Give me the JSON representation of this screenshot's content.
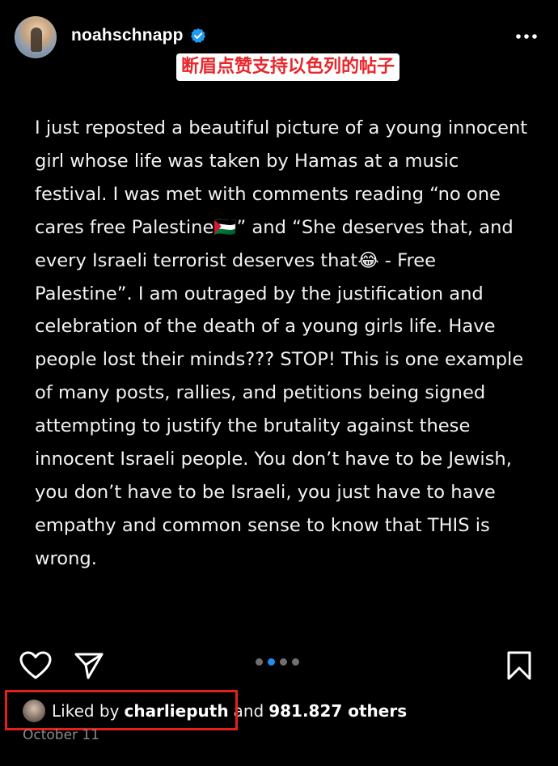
{
  "post": {
    "username": "noahschnapp",
    "verified_icon": "verified-badge-icon",
    "more_icon": "more-horizontal-icon",
    "overlay_label": "断眉点赞支持以色列的帖子",
    "caption": {
      "part1": "I just reposted a beautiful picture of a young innocent girl whose life was taken by Hamas at a music festival. I was met with comments reading “no one cares free Palestine",
      "flag_emoji": "🇵🇸",
      "part2": "” and “She deserves that, and every Israeli terrorist deserves that",
      "laugh_emoji": "😂",
      "part3": " - Free Palestine”. I am outraged by the justification and celebration of the death of a young girls life. Have people lost their minds??? STOP! This is one example of many posts, rallies, and petitions being signed attempting to justify the brutality against these innocent Israeli people. You don’t have to be Jewish, you don’t have to be Israeli, you just have to have empathy and common sense to know that THIS is wrong."
    },
    "carousel": {
      "total": 4,
      "active_index": 1
    },
    "likes": {
      "prefix": "Liked by",
      "liker": "charlieputh",
      "connector": "and",
      "count_text": "981.827 others"
    },
    "date": "October 11"
  },
  "colors": {
    "background": "#000000",
    "verified": "#1d9bf0",
    "highlight_box": "#e3201f",
    "overlay_text": "#e8262b",
    "carousel_active": "#1d8ff0"
  }
}
